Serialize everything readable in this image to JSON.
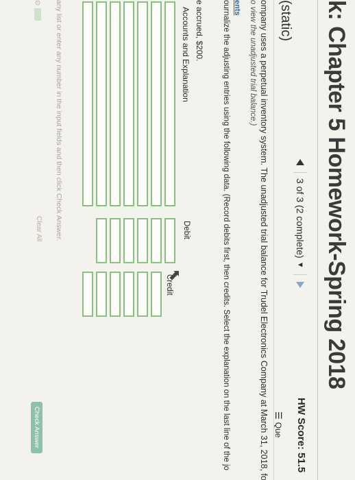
{
  "header": {
    "title": "k: Chapter 5 Homework-Spring 2018",
    "progress": "3 of 3 (2 complete)",
    "hw_score": "HW Score: 51.5",
    "static_label": "(static)",
    "question_label": "Que"
  },
  "problem": {
    "intro": "ompany uses a perpetual inventory system. The unadjusted trial balance for Trudel Electronics Company at March 31, 2018, follo",
    "view_link": "o view the unadjusted trial balance.)",
    "section_tag": "ents",
    "instruction": "ournalize the adjusting entries using the following data. (Record debits first, then credits. Select the explanation on the last line of the jo",
    "accrued_text": "e accrued, $200."
  },
  "journal": {
    "col_account": "Accounts and Explanation",
    "col_debit": "Debit",
    "col_credit": "Credit"
  },
  "footer": {
    "hint": "any list or enter any number in the input fields and then click Check Answer.",
    "clear_all": "Clear All",
    "check_answer": "Check Answer"
  }
}
